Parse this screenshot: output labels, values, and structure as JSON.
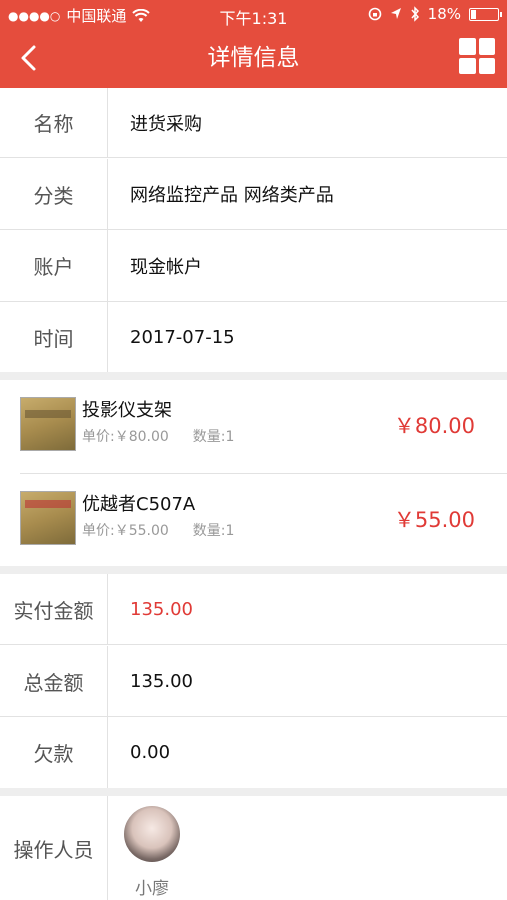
{
  "status_bar": {
    "signal_dots": "●●●●○",
    "carrier": "中国联通",
    "time": "下午1:31",
    "battery_percent": "18%",
    "battery_level": 0.18,
    "icons": [
      "wifi-icon",
      "rotation-lock-icon",
      "location-icon",
      "bluetooth-icon",
      "battery-icon"
    ]
  },
  "nav": {
    "title": "详情信息",
    "back_icon": "chevron-left-icon",
    "menu_icon": "grid-icon"
  },
  "details": [
    {
      "label": "名称",
      "value": "进货采购"
    },
    {
      "label": "分类",
      "value": "网络监控产品 网络类产品"
    },
    {
      "label": "账户",
      "value": "现金帐户"
    },
    {
      "label": "时间",
      "value": "2017-07-15"
    }
  ],
  "products": [
    {
      "name": "投影仪支架",
      "unit_price": "单价:￥80.00",
      "quantity": "数量:1",
      "price": "￥80.00"
    },
    {
      "name": "优越者C507A",
      "unit_price": "单价:￥55.00",
      "quantity": "数量:1",
      "price": "￥55.00"
    }
  ],
  "amounts": [
    {
      "label": "实付金额",
      "value": "135.00",
      "color": "#e03a36"
    },
    {
      "label": "总金额",
      "value": "135.00",
      "color": "#111111"
    },
    {
      "label": "欠款",
      "value": "0.00",
      "color": "#111111"
    }
  ],
  "operator": {
    "label": "操作人员",
    "name": "小廖"
  },
  "colors": {
    "header": "#e54d3d",
    "price": "#e03a36"
  }
}
